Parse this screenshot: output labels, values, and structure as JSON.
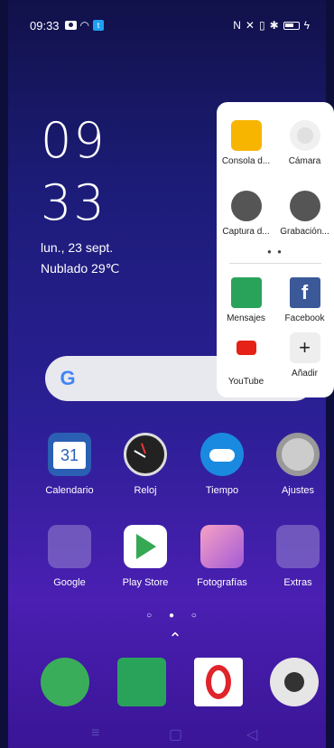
{
  "status_bar": {
    "time": "09:33"
  },
  "lock_clock": {
    "hours": "09",
    "minutes": "33",
    "date": "lun., 23 sept.",
    "weather": "Nublado 29℃"
  },
  "shortcut_popup": {
    "items": [
      {
        "label": "Consola d...",
        "icon": "folder-icon"
      },
      {
        "label": "Cámara",
        "icon": "camera-icon"
      },
      {
        "label": "Captura d...",
        "icon": "crop-icon"
      },
      {
        "label": "Grabación...",
        "icon": "video-record-icon"
      },
      {
        "label": "Mensajes",
        "icon": "messages-icon"
      },
      {
        "label": "Facebook",
        "icon": "facebook-icon"
      },
      {
        "label": "YouTube",
        "icon": "youtube-icon"
      },
      {
        "label": "Añadir",
        "icon": "add-icon"
      }
    ],
    "page_dots": "● ●"
  },
  "search": {
    "logo": "G"
  },
  "apps_row1": [
    {
      "label": "Calendario",
      "icon": "calendar-icon",
      "badge": "31"
    },
    {
      "label": "Reloj",
      "icon": "clock-icon"
    },
    {
      "label": "Tiempo",
      "icon": "weather-icon"
    },
    {
      "label": "Ajustes",
      "icon": "settings-icon"
    }
  ],
  "apps_row2": [
    {
      "label": "Google",
      "icon": "google-folder-icon"
    },
    {
      "label": "Play Store",
      "icon": "play-store-icon"
    },
    {
      "label": "Fotografías",
      "icon": "photos-icon"
    },
    {
      "label": "Extras",
      "icon": "extras-folder-icon"
    }
  ],
  "home_page_dots": "○ ● ○",
  "dock": [
    {
      "icon": "phone-icon"
    },
    {
      "icon": "messages-icon"
    },
    {
      "icon": "opera-icon"
    },
    {
      "icon": "camera-icon"
    }
  ],
  "nav": {
    "menu": "≡",
    "home": "▢",
    "back": "◁"
  }
}
